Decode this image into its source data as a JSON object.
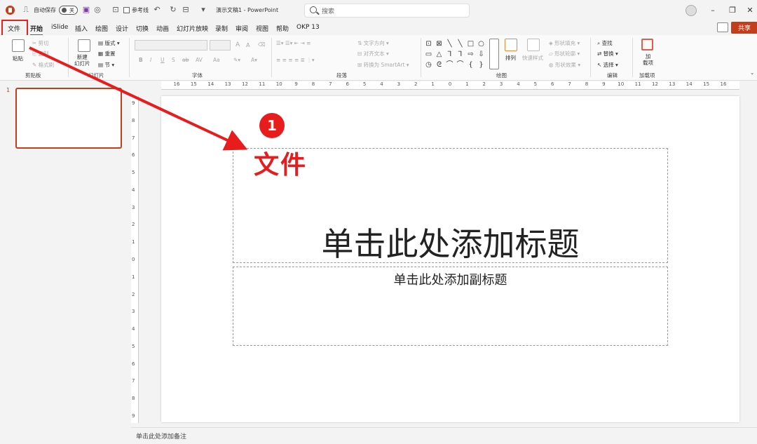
{
  "titlebar": {
    "autosave_label": "自动保存",
    "autosave_state": "关",
    "refline_label": "参考线",
    "doc_title": "演示文稿1 - PowerPoint",
    "search_placeholder": "搜索",
    "minimize": "–",
    "restore": "❐",
    "close": "✕"
  },
  "menu": {
    "items": [
      "文件",
      "开始",
      "iSlide",
      "插入",
      "绘图",
      "设计",
      "切换",
      "动画",
      "幻灯片放映",
      "录制",
      "审阅",
      "视图",
      "帮助",
      "OKP 13"
    ],
    "active_index": 1,
    "share": "共享"
  },
  "ribbon": {
    "clipboard": {
      "paste": "粘贴",
      "cut": "剪切",
      "copy": "复制",
      "format_painter": "格式刷",
      "group": "剪贴板"
    },
    "slides": {
      "new_slide": "新建\n幻灯片",
      "layout": "版式",
      "reset": "重置",
      "section": "节",
      "group": "幻灯片"
    },
    "font": {
      "group": "字体",
      "bold": "B",
      "italic": "I",
      "underline": "U",
      "shadow": "S",
      "strike": "ab",
      "spacing": "AV",
      "case": "Aa",
      "increase": "A",
      "decrease": "A"
    },
    "paragraph": {
      "group": "段落",
      "text_direction": "文字方向",
      "align_text": "对齐文本",
      "smartart": "转换为 SmartArt"
    },
    "drawing": {
      "group": "绘图",
      "arrange": "排列",
      "quick_styles": "快速样式",
      "shape_fill": "形状填充",
      "shape_outline": "形状轮廓",
      "shape_effects": "形状效果"
    },
    "editing": {
      "group": "编辑",
      "find": "查找",
      "replace": "替换",
      "select": "选择"
    },
    "addins": {
      "group": "加载项",
      "button": "加\n载项"
    }
  },
  "slide_panel": {
    "number": "1"
  },
  "rulers": {
    "h_ticks": [
      "16",
      "15",
      "14",
      "13",
      "12",
      "11",
      "10",
      "9",
      "8",
      "7",
      "6",
      "5",
      "4",
      "3",
      "2",
      "1",
      "0",
      "1",
      "2",
      "3",
      "4",
      "5",
      "6",
      "7",
      "8",
      "9",
      "10",
      "11",
      "12",
      "13",
      "14",
      "15",
      "16"
    ],
    "v_ticks": [
      "9",
      "8",
      "7",
      "6",
      "5",
      "4",
      "3",
      "2",
      "1",
      "0",
      "1",
      "2",
      "3",
      "4",
      "5",
      "6",
      "7",
      "8",
      "9"
    ]
  },
  "slide": {
    "title_placeholder": "单击此处添加标题",
    "subtitle_placeholder": "单击此处添加副标题"
  },
  "annotation": {
    "step": "1",
    "label": "文件"
  },
  "notes": {
    "placeholder": "单击此处添加备注"
  }
}
